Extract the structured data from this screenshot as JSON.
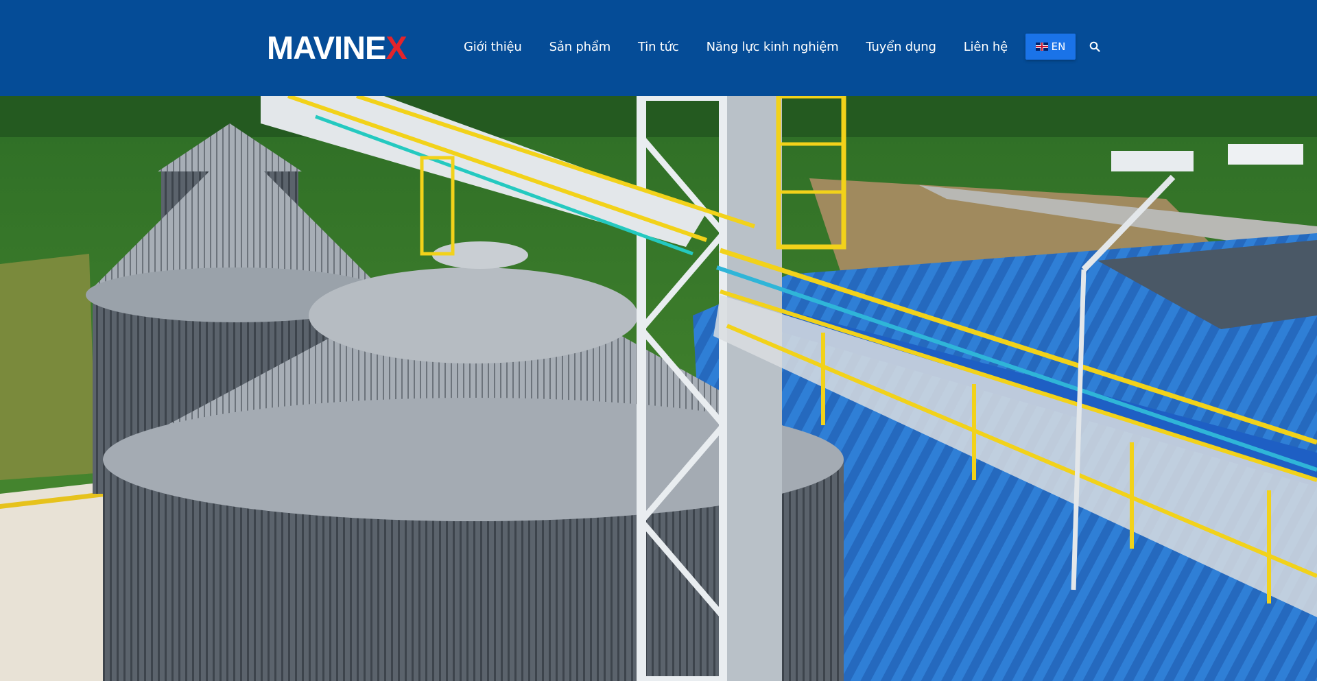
{
  "header": {
    "logo": {
      "text_main": "MAVINE",
      "text_accent": "X"
    },
    "nav": [
      {
        "label": "Giới thiệu"
      },
      {
        "label": "Sản phẩm"
      },
      {
        "label": "Tin tức"
      },
      {
        "label": "Năng lực kinh nghiệm"
      },
      {
        "label": "Tuyển dụng"
      },
      {
        "label": "Liên hệ"
      }
    ],
    "language": {
      "label": "EN",
      "flag_icon": "uk-flag-icon"
    },
    "search_icon": "search-icon"
  },
  "hero": {
    "image_subject": "aerial view of grain silos and conveyor",
    "alt": "hero-image"
  },
  "colors": {
    "header_bg": "#054c97",
    "lang_button": "#1a73e8",
    "logo_accent": "#e3242b"
  }
}
